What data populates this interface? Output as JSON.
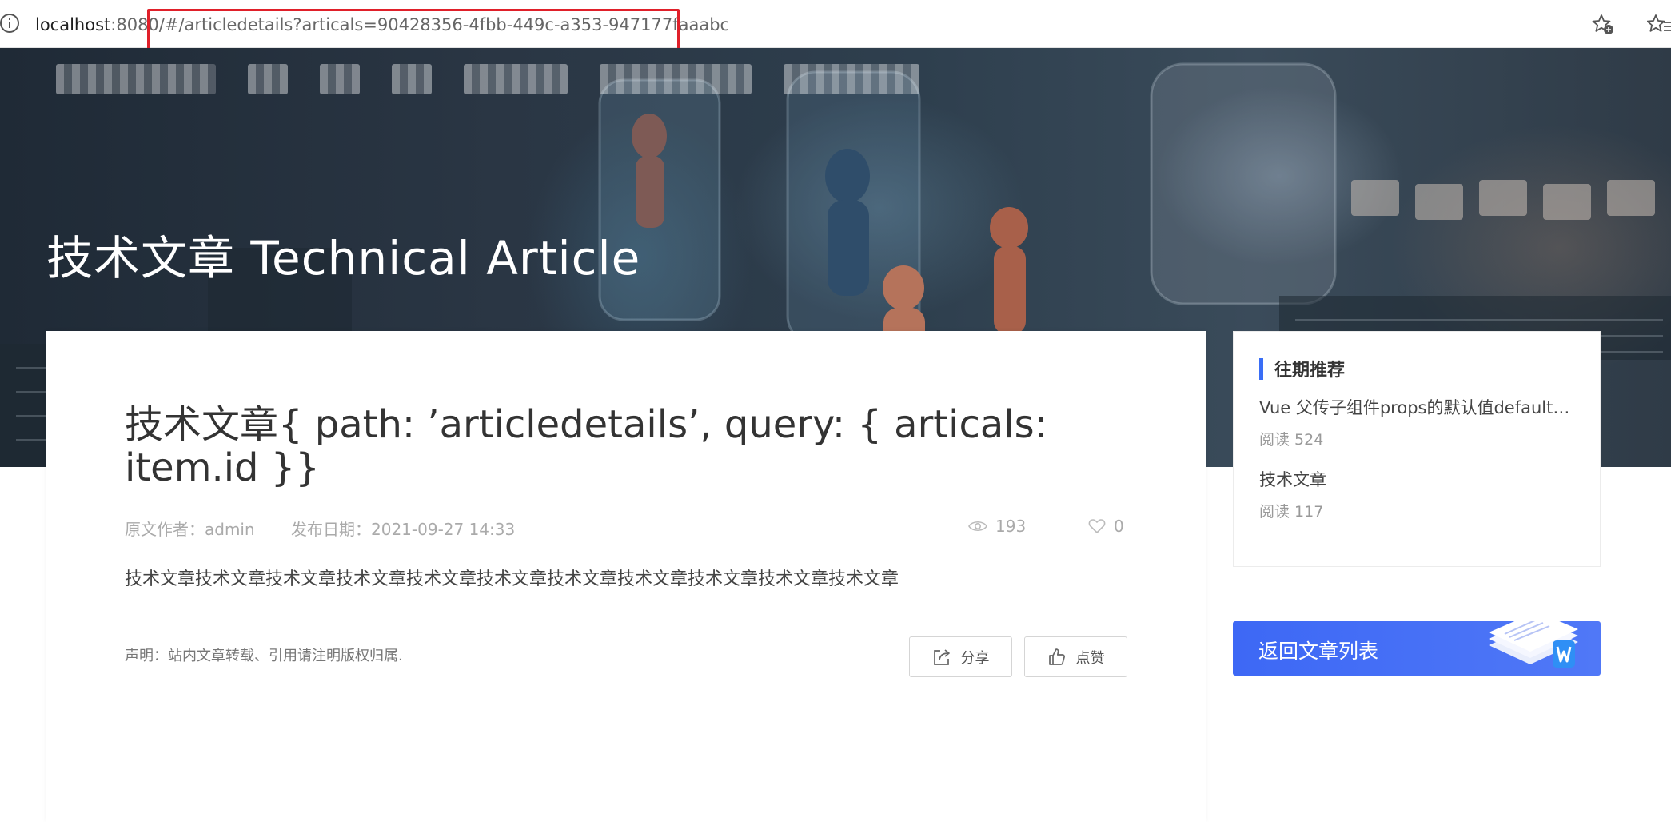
{
  "browser": {
    "url_host": "localhost",
    "url_port": ":8080/",
    "url_hash": "#/articledetails?articals=90428356-4fbb-449c-a353-947177faaabc",
    "icons": {
      "info": "info-icon",
      "favorite": "star-add-icon",
      "favorites_bar": "favorites-icon"
    }
  },
  "banner": {
    "title": "技术文章 Technical Article"
  },
  "article": {
    "title": "技术文章{ path: ’articledetails’, query: { articals: item.id }}",
    "author": "原文作者：admin",
    "date": "发布日期：2021-09-27 14:33",
    "views": "193",
    "likes": "0",
    "body": "技术文章技术文章技术文章技术文章技术文章技术文章技术文章技术文章技术文章技术文章技术文章",
    "statement": "声明：站内文章转载、引用请注明版权归属.",
    "share_label": "分享",
    "like_label": "点赞"
  },
  "sidebar": {
    "heading": "往期推荐",
    "items": [
      {
        "title": "Vue 父传子组件props的默认值default…",
        "reads": "阅读 524"
      },
      {
        "title": "技术文章",
        "reads": "阅读 117"
      }
    ],
    "back_label": "返回文章列表"
  },
  "colors": {
    "accent": "#3a6ef6",
    "highlight_box": "#e0202a",
    "banner_title": "#ffffff"
  }
}
